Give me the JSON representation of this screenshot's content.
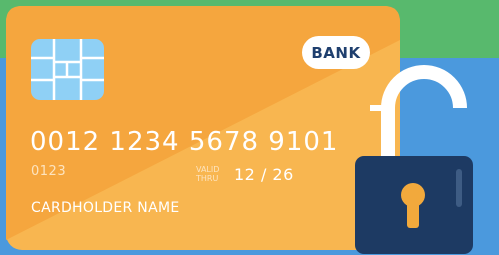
{
  "colors": {
    "background_green": "#58b96d",
    "background_blue": "#4b99dd",
    "card_orange": "#f5a63e",
    "card_orange_light": "#f8b650",
    "chip_blue": "#8fd0f5",
    "lock_body_navy": "#1d3a63",
    "lock_keyhole": "#f2a93c",
    "text_white": "#ffffff"
  },
  "card": {
    "bank_name": "BANK",
    "number": "0012 1234 5678 9101",
    "code": "0123",
    "valid_label_line1": "VALID",
    "valid_label_line2": "THRU",
    "expiry": "12 / 26",
    "holder_name": "CARDHOLDER NAME"
  },
  "icons": {
    "chip": "chip-icon",
    "lock": "open-padlock-icon",
    "keyhole": "keyhole-icon"
  }
}
